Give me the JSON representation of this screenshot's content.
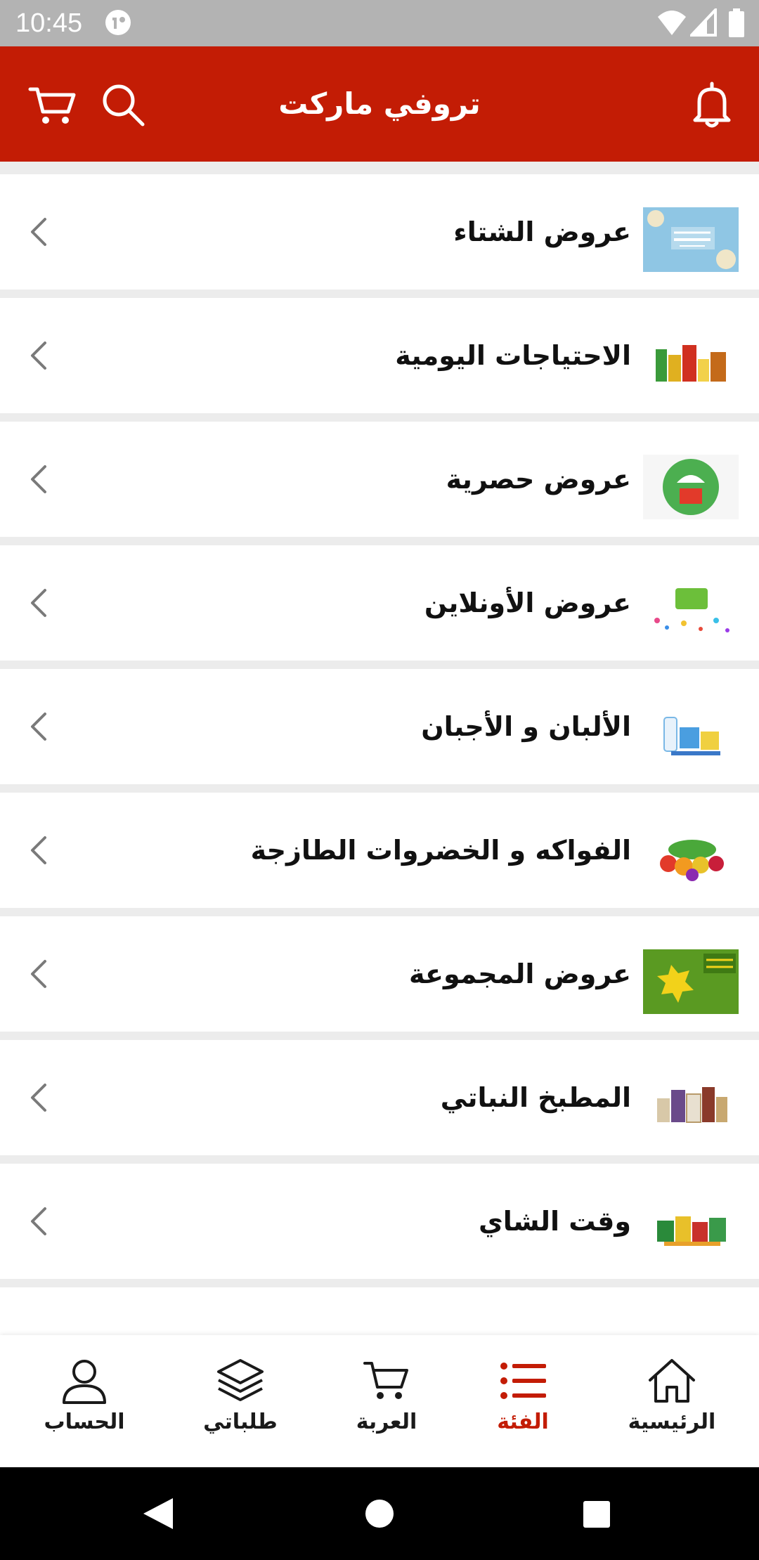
{
  "status_bar": {
    "time": "10:45",
    "icons": [
      "app-badge-icon",
      "wifi-icon",
      "signal-icon",
      "battery-icon"
    ]
  },
  "header": {
    "title": "تروفي ماركت",
    "background": "#c31c05",
    "icons": [
      "bell-icon",
      "search-icon",
      "cart-icon"
    ]
  },
  "categories": [
    {
      "label": "عروض الشتاء",
      "thumb": "winter-warmers-thumbnail"
    },
    {
      "label": "الاحتياجات اليومية",
      "thumb": "daily-needs-thumbnail"
    },
    {
      "label": "عروض حصرية",
      "thumb": "exclusive-offers-thumbnail"
    },
    {
      "label": "عروض الأونلاين",
      "thumb": "online-deals-thumbnail"
    },
    {
      "label": "الألبان و الأجبان",
      "thumb": "dairy-cheese-thumbnail"
    },
    {
      "label": "الفواكه و الخضروات الطازجة",
      "thumb": "fruits-vegetables-thumbnail"
    },
    {
      "label": "عروض المجموعة",
      "thumb": "bundle-blast-thumbnail"
    },
    {
      "label": "المطبخ النباتي",
      "thumb": "plant-kitchen-thumbnail"
    },
    {
      "label": "وقت الشاي",
      "thumb": "tea-time-thumbnail"
    }
  ],
  "bottom_nav": {
    "items": [
      {
        "label": "الحساب",
        "icon": "user-icon",
        "active": false
      },
      {
        "label": "طلباتي",
        "icon": "layers-icon",
        "active": false
      },
      {
        "label": "العربة",
        "icon": "cart-icon",
        "active": false
      },
      {
        "label": "الفئة",
        "icon": "list-icon",
        "active": true
      },
      {
        "label": "الرئيسية",
        "icon": "home-icon",
        "active": false
      }
    ],
    "active_color": "#c31c05"
  },
  "system_nav": {
    "icons": [
      "back-icon",
      "home-circle-icon",
      "recents-icon"
    ]
  }
}
